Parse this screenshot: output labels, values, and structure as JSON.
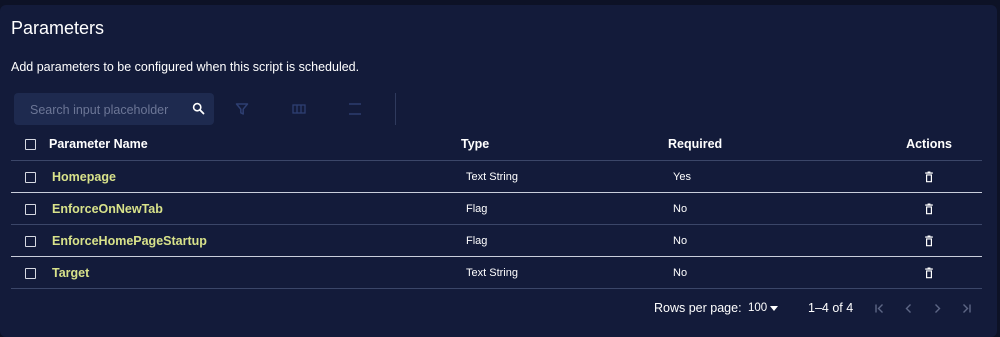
{
  "section": {
    "title": "Parameters",
    "description": "Add parameters to be configured when this script is scheduled."
  },
  "toolbar": {
    "search_placeholder": "Search input placeholder",
    "icons": [
      "search-icon",
      "filter-icon",
      "columns-icon",
      "density-icon"
    ]
  },
  "table": {
    "headers": {
      "name": "Parameter Name",
      "type": "Type",
      "required": "Required",
      "actions": "Actions"
    },
    "rows": [
      {
        "name": "Homepage",
        "type": "Text String",
        "required": "Yes"
      },
      {
        "name": "EnforceOnNewTab",
        "type": "Flag",
        "required": "No"
      },
      {
        "name": "EnforceHomePageStartup",
        "type": "Flag",
        "required": "No"
      },
      {
        "name": "Target",
        "type": "Text String",
        "required": "No"
      }
    ]
  },
  "pagination": {
    "rows_per_page_label": "Rows per page:",
    "rows_per_page_value": "100",
    "range": "1–4 of 4"
  },
  "colors": {
    "background": "#0d1226",
    "panel": "#131b3a",
    "name_accent": "#d8e28a"
  }
}
